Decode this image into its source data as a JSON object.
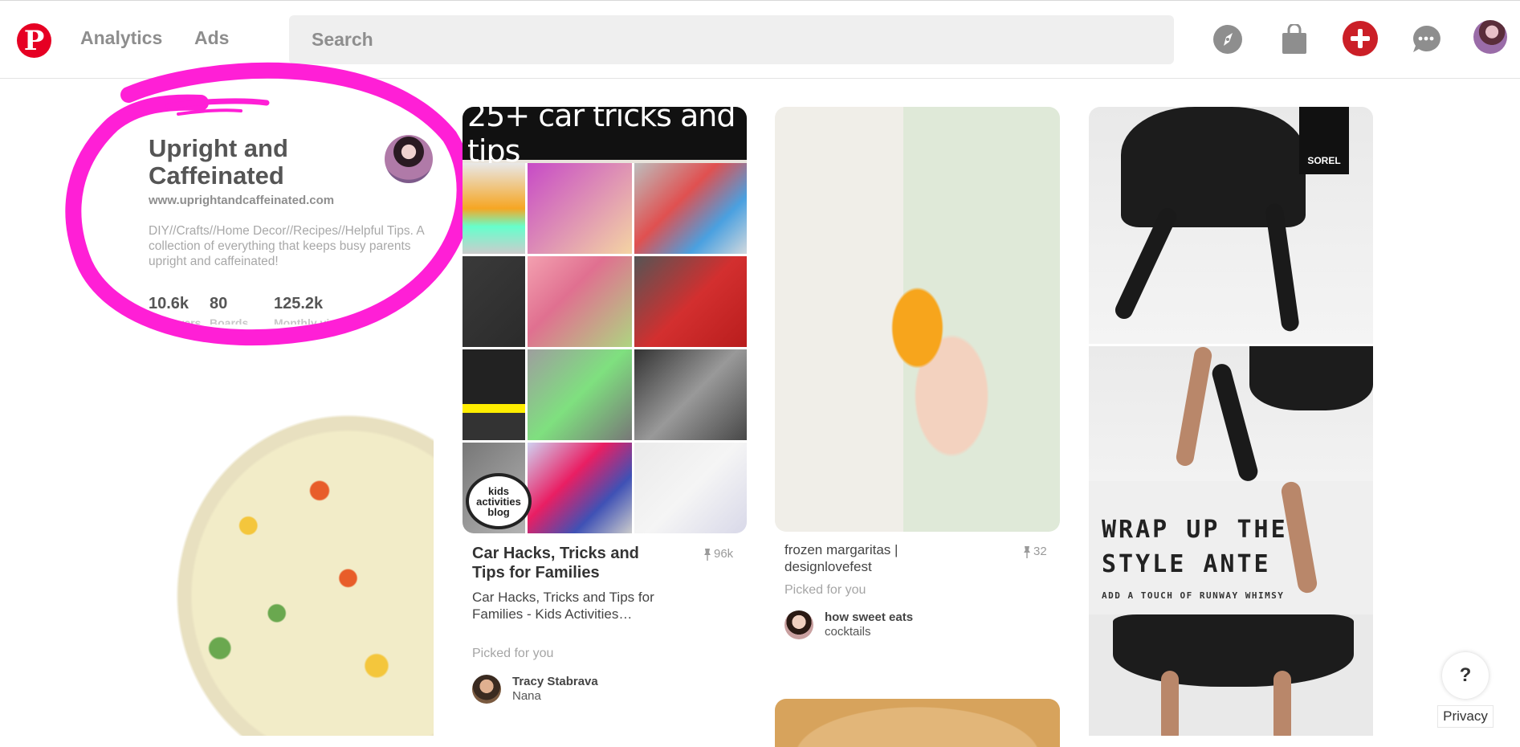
{
  "header": {
    "logo_letter": "P",
    "nav": [
      "Analytics",
      "Ads"
    ],
    "search_placeholder": "Search",
    "icons": [
      "compass-icon",
      "shopping-bag-icon",
      "plus-icon",
      "chat-icon",
      "avatar"
    ],
    "brand_red": "#e60023"
  },
  "profile": {
    "name": "Upright and Caffeinated",
    "url": "www.uprightandcaffeinated.com",
    "bio": "DIY//Crafts//Home Decor//Recipes//Helpful Tips. A collection of everything that keeps busy parents upright and caffeinated!",
    "stats": [
      {
        "value": "10.6k",
        "label": "Followers"
      },
      {
        "value": "80",
        "label": "Boards"
      },
      {
        "value": "125.2k",
        "label": "Monthly viewers"
      }
    ],
    "annotation_color": "#ff1fd6"
  },
  "pins": {
    "car": {
      "image_heading": "25+ car tricks and tips",
      "badge": "kids activities blog",
      "title": "Car Hacks, Tricks and Tips for Families",
      "saves": "96k",
      "description": "Car Hacks, Tricks and Tips for Families - Kids Activities…",
      "picked": "Picked for you",
      "pinner_name": "Tracy Stabrava",
      "pinner_board": "Nana"
    },
    "margarita": {
      "title": "frozen margaritas | designlovefest",
      "saves": "32",
      "picked": "Picked for you",
      "pinner_name": "how sweet eats",
      "pinner_board": "cocktails"
    },
    "sorel": {
      "logo": "SOREL",
      "headline_1": "WRAP UP THE",
      "headline_2": "STYLE ANTE",
      "subline": "ADD A TOUCH OF RUNWAY WHIMSY"
    }
  },
  "footer": {
    "help": "?",
    "privacy": "Privacy"
  }
}
